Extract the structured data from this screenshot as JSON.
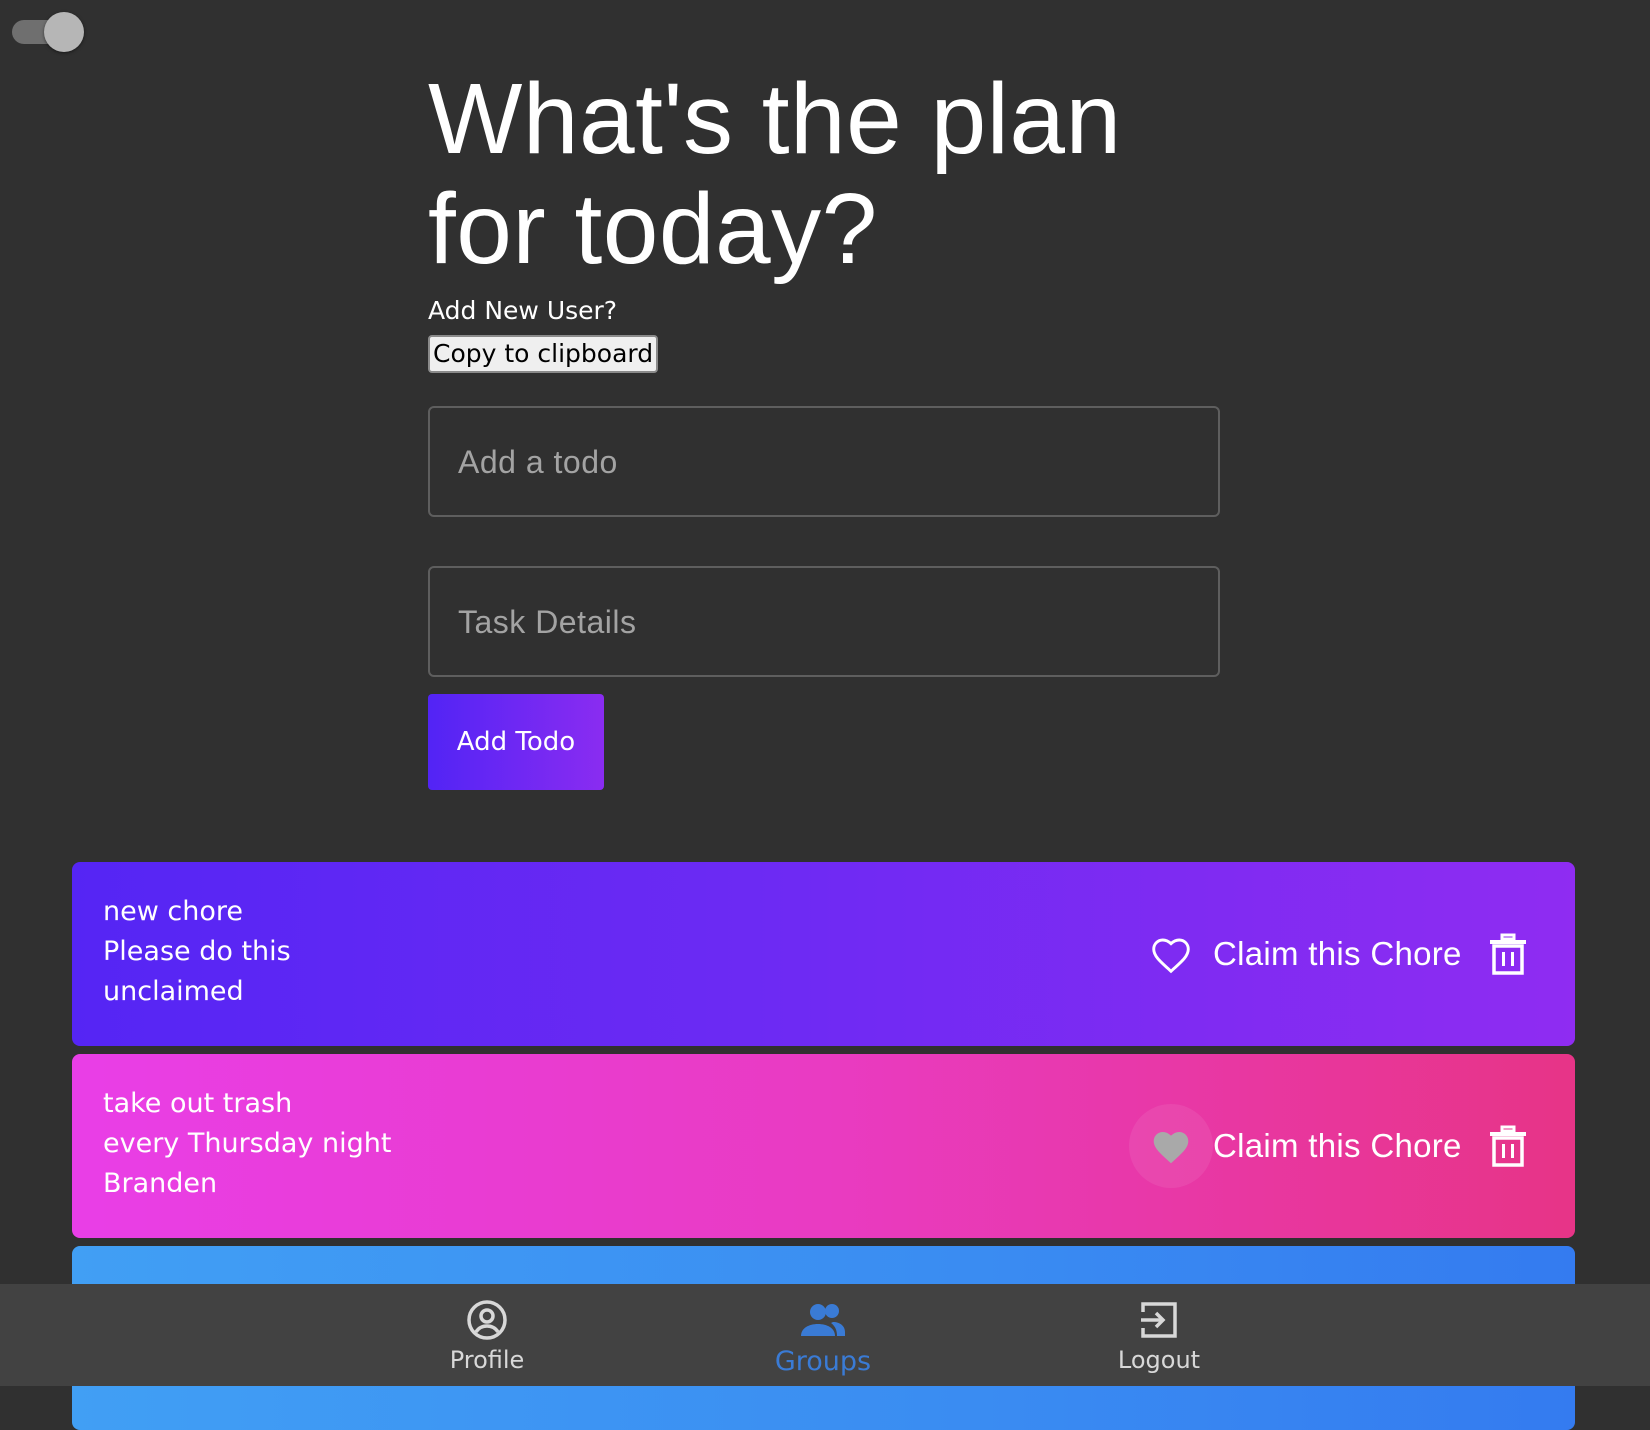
{
  "theme_toggle": {
    "state": "on"
  },
  "header": {
    "title_line1": "What's the plan",
    "title_line2": "for today?",
    "add_user_label": "Add New User?",
    "copy_button_label": "Copy to clipboard"
  },
  "form": {
    "todo_placeholder": "Add a todo",
    "todo_value": "",
    "details_placeholder": "Task Details",
    "details_value": "",
    "add_button_label": "Add Todo"
  },
  "chores": [
    {
      "title": "new chore",
      "details": "Please do this",
      "assignee": "unclaimed",
      "claim_label": "Claim this Chore",
      "heart_icon": "heart-outline-icon",
      "trash_icon": "trash-icon",
      "color_start": "#5525f4",
      "color_end": "#8f2cf2"
    },
    {
      "title": "take out trash",
      "details": "every Thursday night",
      "assignee": "Branden",
      "claim_label": "Claim this Chore",
      "heart_icon": "heart-filled-icon",
      "trash_icon": "trash-icon",
      "color_start": "#e93ee7",
      "color_end": "#e73487"
    },
    {
      "color_start": "#419ff4",
      "color_end": "#347bf0"
    }
  ],
  "bottom_nav": {
    "items": [
      {
        "label": "Profile",
        "icon": "account-circle-icon",
        "active": false
      },
      {
        "label": "Groups",
        "icon": "group-icon",
        "active": true
      },
      {
        "label": "Logout",
        "icon": "logout-icon",
        "active": false
      }
    ],
    "active_color": "#3a7bd5"
  },
  "colors": {
    "background": "#303030",
    "nav_background": "#424242",
    "button_gradient_start": "#5224f5",
    "button_gradient_end": "#8a2cf1"
  }
}
